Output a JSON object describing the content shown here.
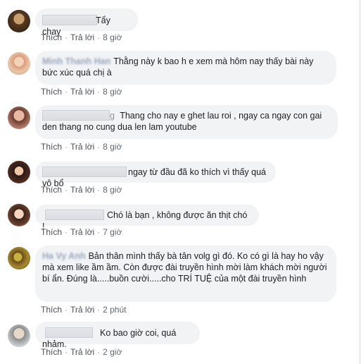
{
  "comments": [
    {
      "author": "",
      "text": "Tẩy chay",
      "actions": {
        "like": "Thích",
        "reply": "Trả lời",
        "time": "8 giờ"
      }
    },
    {
      "author": "Minh Thanh Han",
      "text": "Thằng này k bao h e xem mà hôm nay thấy bài này bức xúc quá chị à",
      "actions": {
        "like": "Thích",
        "reply": "Trả lời",
        "time": "8 giờ"
      }
    },
    {
      "author": "g",
      "text": "Thang cho nay e ghet lau roi , ngay ca ngay con gai den thang no cung dua len lam youtube",
      "actions": {
        "like": "Thích",
        "reply": "Trả lời",
        "time": "8 giờ"
      }
    },
    {
      "author": "",
      "text": "ngay từ đầu đã ko thích vì thấy quá vô bổ",
      "actions": {
        "like": "Thích",
        "reply": "Trả lời",
        "time": "8 giờ"
      }
    },
    {
      "author": "",
      "text": "Chó là bạn , không được ăn thịt chó !",
      "actions": {
        "like": "Thích",
        "reply": "Trả lời",
        "time": "7 giờ"
      }
    },
    {
      "author": "Ha Vy Anh",
      "text": "Bản thân mình thấy bà tân volg gì đó. Ko có gì là hay ho vậy mà xem like ầm ầm. Còn được đài truyền hình mời làm khách mời người bí ẩn. Đúng là.....buồn cười.....cho TRÍ TUỆ của một đài truyền hình",
      "actions": {
        "like": "Thích",
        "reply": "Trả lời",
        "time": "2 phút"
      }
    },
    {
      "author": "",
      "text": "Ko bao giờ coi, quá nhảm.",
      "actions": {
        "like": "Thích",
        "reply": "Trả lời",
        "time": "2 giờ"
      }
    }
  ]
}
